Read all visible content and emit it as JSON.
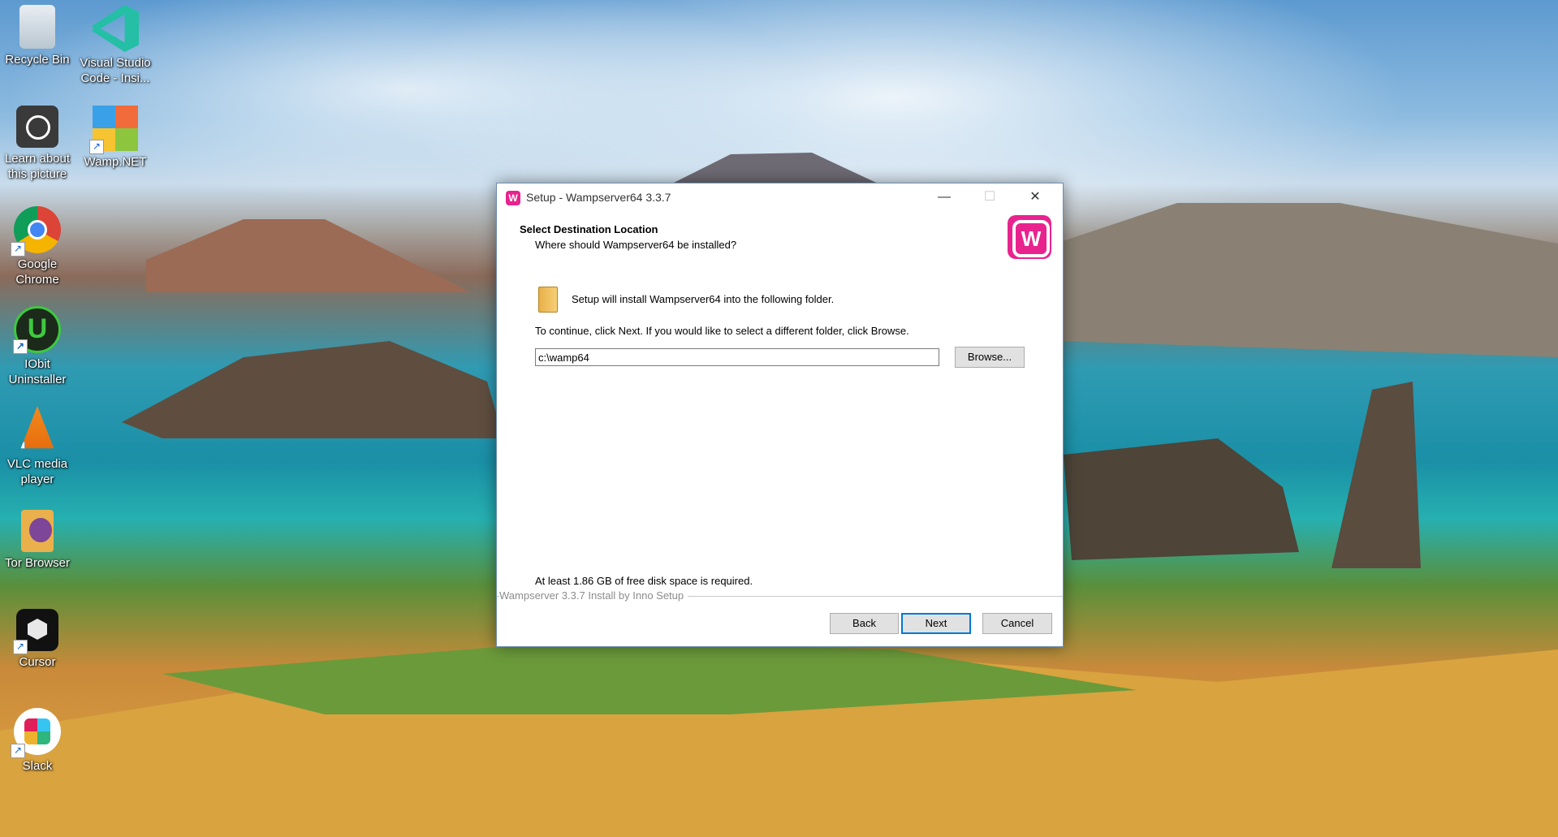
{
  "desktop": {
    "icons": [
      {
        "label": "Recycle Bin"
      },
      {
        "label": "Visual Studio Code - Insi..."
      },
      {
        "label": "Learn about this picture"
      },
      {
        "label": "Wamp.NET"
      },
      {
        "label": "Google Chrome"
      },
      {
        "label": "IObit Uninstaller"
      },
      {
        "label": "VLC media player"
      },
      {
        "label": "Tor Browser"
      },
      {
        "label": "Cursor"
      },
      {
        "label": "Slack"
      }
    ]
  },
  "dialog": {
    "title": "Setup - Wampserver64 3.3.7",
    "logo_letter": "W",
    "header_title": "Select Destination Location",
    "header_subtitle": "Where should Wampserver64 be installed?",
    "info_text": "Setup will install Wampserver64 into the following folder.",
    "continue_text": "To continue, click Next. If you would like to select a different folder, click Browse.",
    "path_value": "c:\\wamp64",
    "browse_label": "Browse...",
    "disk_space_text": "At least 1.86 GB of free disk space is required.",
    "footer_brand": "Wampserver 3.3.7 Install by Inno Setup",
    "back_label": "Back",
    "next_label": "Next",
    "cancel_label": "Cancel",
    "minimize_glyph": "—",
    "maximize_glyph": "☐",
    "close_glyph": "✕"
  },
  "colors": {
    "accent": "#0078d7",
    "wamp_brand": "#e8238e"
  }
}
